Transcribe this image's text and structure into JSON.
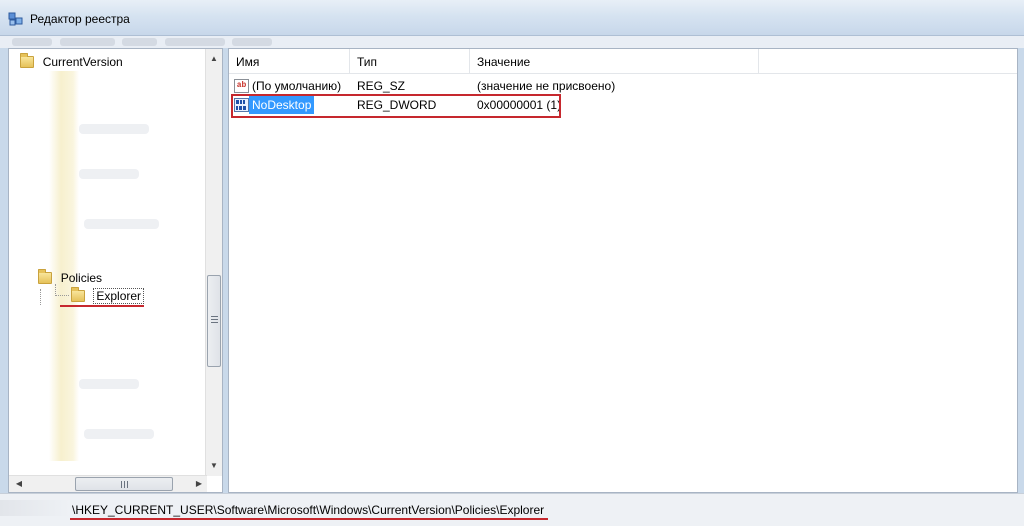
{
  "window": {
    "title": "Редактор реестра"
  },
  "tree": {
    "items": [
      {
        "label": "CurrentVersion"
      },
      {
        "label": "Policies"
      },
      {
        "label": "Explorer"
      }
    ],
    "scroll_up": "▲",
    "scroll_down": "▼",
    "scroll_left": "◀",
    "scroll_right": "▶"
  },
  "list": {
    "columns": [
      {
        "label": "Имя"
      },
      {
        "label": "Тип"
      },
      {
        "label": "Значение"
      }
    ],
    "rows": [
      {
        "icon": "string-value-icon",
        "icon_text": "ab",
        "name": "(По умолчанию)",
        "type": "REG_SZ",
        "value": "(значение не присвоено)"
      },
      {
        "icon": "dword-value-icon",
        "icon_text": "011\n110",
        "name": "NoDesktop",
        "type": "REG_DWORD",
        "value": "0x00000001 (1)"
      }
    ]
  },
  "status": {
    "path": "\\HKEY_CURRENT_USER\\Software\\Microsoft\\Windows\\CurrentVersion\\Policies\\Explorer"
  },
  "colors": {
    "selection": "#3399ff",
    "annotation_red": "#c6282e"
  }
}
